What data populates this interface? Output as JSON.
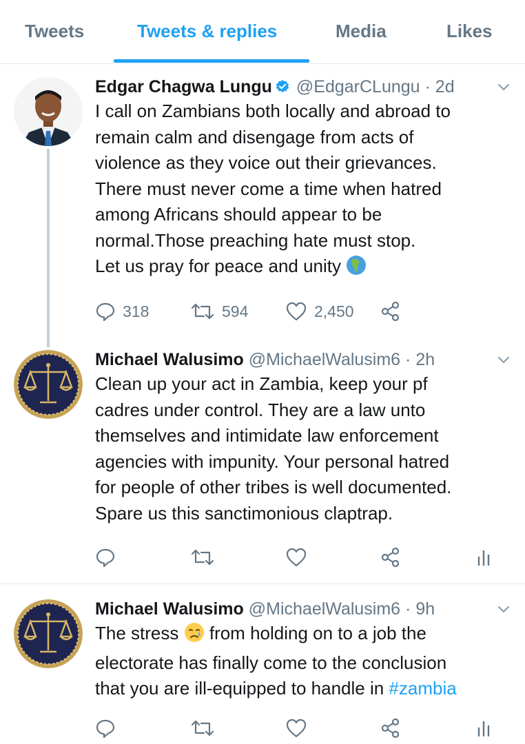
{
  "tabs": {
    "tweets": "Tweets",
    "tweets_replies": "Tweets & replies",
    "media": "Media",
    "likes": "Likes"
  },
  "colors": {
    "accent": "#1da1f2",
    "muted": "#657786",
    "text": "#14171a"
  },
  "tweets": [
    {
      "name": "Edgar Chagwa Lungu",
      "verified": true,
      "handle": "@EdgarCLungu",
      "time": "· 2d",
      "lines": [
        "I call on Zambians both locally and abroad to",
        "remain calm and disengage from acts of",
        "violence as they voice out their grievances.",
        "There must never come a time when hatred",
        "among Africans should appear to be",
        "normal.Those preaching hate must stop.",
        "Let us pray for peace and unity"
      ],
      "emoji": "globe-africa-emoji",
      "replies": "318",
      "retweets": "594",
      "likes": "2,450"
    },
    {
      "name": "Michael Walusimo",
      "handle": "@MichaelWalusim6",
      "time": "· 2h",
      "lines": [
        "Clean up your act in Zambia, keep your pf",
        "cadres under control. They are a law unto",
        "themselves and intimidate law enforcement",
        "agencies with impunity. Your personal hatred",
        "for people of other tribes is well documented.",
        "Spare us this sanctimonious claptrap."
      ]
    },
    {
      "name": "Michael Walusimo",
      "handle": "@MichaelWalusim6",
      "time": "· 9h",
      "line1_before": "The stress",
      "line1_after": "from holding on to a job the",
      "emoji": "sad-relieved-face-emoji",
      "line2": "electorate has finally come to the conclusion",
      "line3_before": "that you are ill-equipped to handle in",
      "hashtag": "#zambia"
    }
  ]
}
